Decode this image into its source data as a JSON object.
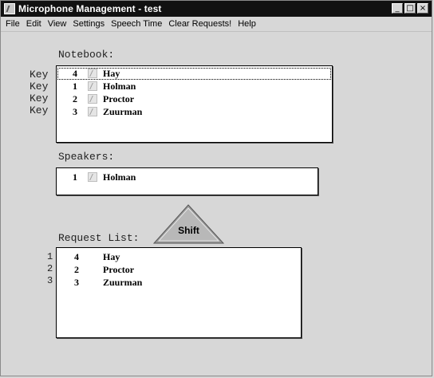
{
  "window": {
    "title": "Microphone Management - test",
    "controls": [
      "_",
      "□",
      "×"
    ]
  },
  "menu": [
    "File",
    "Edit",
    "View",
    "Settings",
    "Speech Time",
    "Clear Requests!",
    "Help"
  ],
  "notebook": {
    "label": "Notebook:",
    "key_label": "Key",
    "rows": [
      {
        "key": "Key",
        "num": "4",
        "name": "Hay"
      },
      {
        "key": "Key",
        "num": "1",
        "name": "Holman"
      },
      {
        "key": "Key",
        "num": "2",
        "name": "Proctor"
      },
      {
        "key": "Key",
        "num": "3",
        "name": "Zuurman"
      }
    ]
  },
  "speakers": {
    "label": "Speakers:",
    "rows": [
      {
        "num": "1",
        "name": "Holman"
      }
    ]
  },
  "shift_button": {
    "label": "Shift"
  },
  "request_list": {
    "label": "Request List:",
    "rows": [
      {
        "index": "1",
        "num": "4",
        "name": "Hay"
      },
      {
        "index": "2",
        "num": "2",
        "name": "Proctor"
      },
      {
        "index": "3",
        "num": "3",
        "name": "Zuurman"
      }
    ]
  },
  "colors": {
    "titlebar": "#111111",
    "background": "#d7d7d7",
    "list_bg": "#ffffff"
  }
}
